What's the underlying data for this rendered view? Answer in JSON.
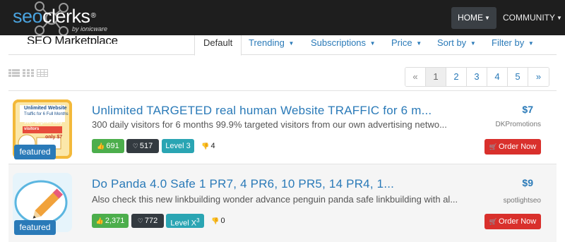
{
  "brand": {
    "prefix": "seo",
    "suffix": "clerks",
    "reg": "®",
    "tagline": "by ionicware"
  },
  "nav": {
    "home": "HOME",
    "community": "COMMUNITY"
  },
  "page_title": {
    "bold": "SEO Marketplace"
  },
  "tabs": [
    {
      "label": "Default",
      "active": true
    },
    {
      "label": "Trending"
    },
    {
      "label": "Subscriptions"
    },
    {
      "label": "Price"
    },
    {
      "label": "Sort by"
    },
    {
      "label": "Filter by"
    }
  ],
  "pagination": {
    "prev": "«",
    "pages": [
      "1",
      "2",
      "3",
      "4",
      "5"
    ],
    "next": "»",
    "current": "1"
  },
  "listings": [
    {
      "title": "Unlimited TARGETED real human Website TRAFFIC for 6 m...",
      "description": "300 daily visitors for 6 months 99.9% targeted visitors from our own advertising netwo...",
      "likes": "691",
      "hearts": "517",
      "level": "Level 3",
      "dislikes": "4",
      "price": "$7",
      "seller": "DKPromotions",
      "order_label": "Order Now",
      "featured_label": "featured",
      "thumb_text": {
        "line1": "Unlimited Website",
        "line2": "Traffic for 6 Full Months",
        "line3": "300+ targeted daily visitors",
        "line4": "only $7"
      }
    },
    {
      "title": "Do Panda 4.0 Safe 1 PR7, 4 PR6, 10 PR5, 14 PR4, 1...",
      "description": "Also check this new linkbuilding wonder advance penguin panda safe linkbuilding with al...",
      "likes": "2,371",
      "hearts": "772",
      "level": "Level X",
      "level_sup": "3",
      "dislikes": "0",
      "price": "$9",
      "seller": "spotlightseo",
      "order_label": "Order Now",
      "featured_label": "featured"
    }
  ],
  "colors": {
    "accent": "#2a7ab8",
    "order": "#d9302c",
    "likes": "#4cae4c",
    "level": "#2aa5b3",
    "hearts": "#333a40"
  }
}
